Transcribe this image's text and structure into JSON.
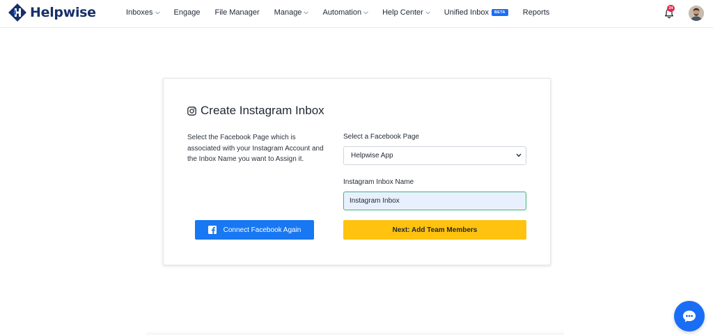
{
  "brand": {
    "name": "Helpwise",
    "color": "#17306b",
    "accent": "#1a6ef5"
  },
  "nav": {
    "items": [
      {
        "label": "Inboxes",
        "dropdown": true
      },
      {
        "label": "Engage",
        "dropdown": false
      },
      {
        "label": "File Manager",
        "dropdown": false
      },
      {
        "label": "Manage",
        "dropdown": true
      },
      {
        "label": "Automation",
        "dropdown": true
      },
      {
        "label": "Help Center",
        "dropdown": true
      },
      {
        "label": "Unified Inbox",
        "dropdown": false,
        "badge": "BETA"
      },
      {
        "label": "Reports",
        "dropdown": false
      }
    ],
    "notifications_count": "24",
    "icons": {
      "notifications": "bell-icon",
      "avatar": "user-avatar"
    }
  },
  "card": {
    "title": "Create Instagram Inbox",
    "title_icon": "instagram-icon",
    "description": "Select the Facebook Page which is associated with your Instagram Account and the Inbox Name you want to Assign it.",
    "facebook_page": {
      "label": "Select a Facebook Page",
      "selected": "Helpwise App"
    },
    "inbox_name": {
      "label": "Instagram Inbox Name",
      "value": "Instagram Inbox"
    },
    "connect_button": {
      "label": "Connect Facebook Again",
      "icon": "facebook-icon",
      "color": "#1877f2"
    },
    "next_button": {
      "label": "Next: Add Team Members",
      "color": "#fec20f"
    }
  },
  "chat_widget": {
    "icon": "chat-bubble-icon"
  }
}
